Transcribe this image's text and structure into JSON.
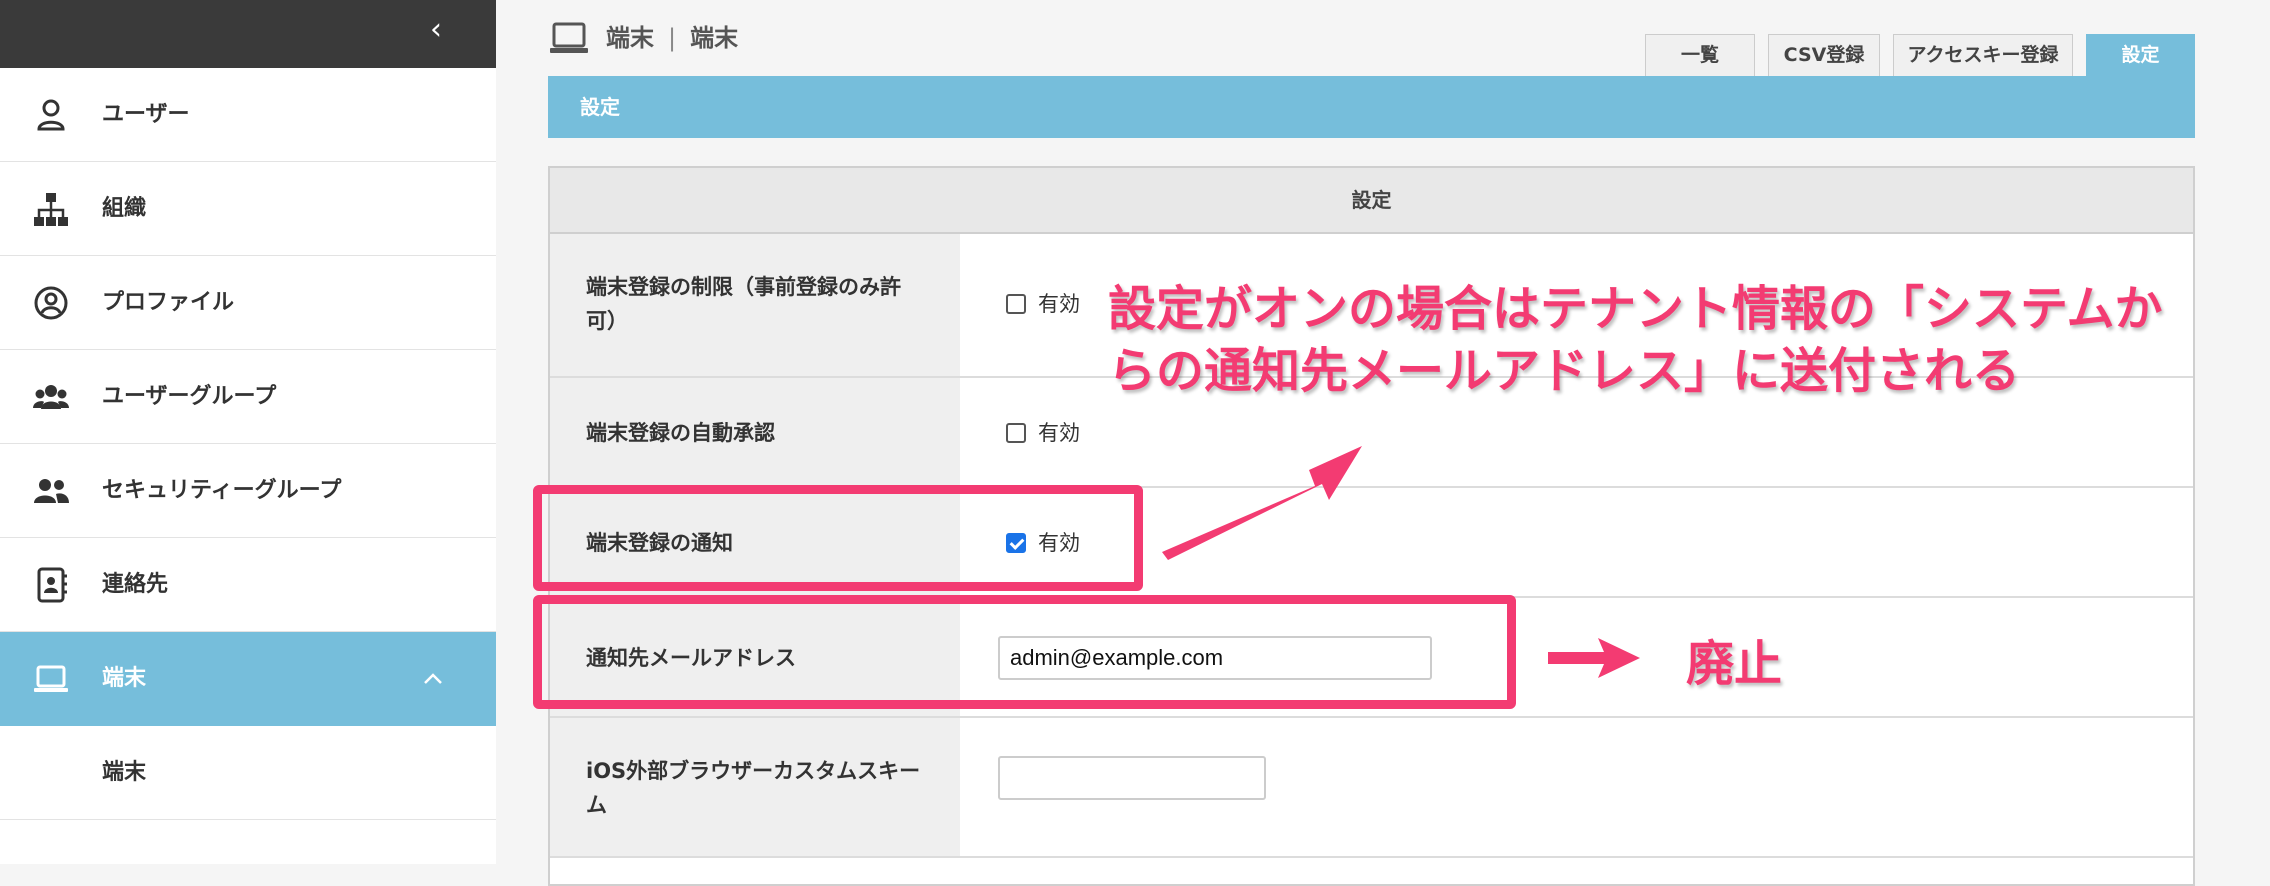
{
  "sidebar": {
    "items": [
      {
        "label": "ユーザー",
        "icon": "user-icon"
      },
      {
        "label": "組織",
        "icon": "org-chart-icon"
      },
      {
        "label": "プロファイル",
        "icon": "profile-circle-icon"
      },
      {
        "label": "ユーザーグループ",
        "icon": "users-group-icon"
      },
      {
        "label": "セキュリティーグループ",
        "icon": "security-group-icon"
      },
      {
        "label": "連絡先",
        "icon": "contact-book-icon"
      },
      {
        "label": "端末",
        "icon": "laptop-icon"
      }
    ],
    "sub_items": [
      {
        "label": "端末"
      }
    ],
    "collapse_icon": "chevron-left-icon"
  },
  "header": {
    "breadcrumb_1": "端末",
    "breadcrumb_sep": "|",
    "breadcrumb_2": "端末",
    "tabs": [
      {
        "label": "一覧"
      },
      {
        "label": "CSV登録"
      },
      {
        "label": "アクセスキー登録"
      },
      {
        "label": "設定"
      }
    ],
    "active_tab": "設定"
  },
  "panel": {
    "title": "設定",
    "table_header": "設定",
    "rows": [
      {
        "label": "端末登録の制限（事前登録のみ許可）",
        "checkbox_label": "有効",
        "checked": false
      },
      {
        "label": "端末登録の自動承認",
        "checkbox_label": "有効",
        "checked": false
      },
      {
        "label": "端末登録の通知",
        "checkbox_label": "有効",
        "checked": true
      },
      {
        "label": "通知先メールアドレス",
        "input_value": "admin@example.com"
      },
      {
        "label": "iOS外部ブラウザーカスタムスキーム",
        "input_value": ""
      }
    ]
  },
  "annotations": {
    "note_line1": "設定がオンの場合はテナント情報の「システムか",
    "note_line2": "らの通知先メールアドレス」に送付される",
    "deprecated": "廃止",
    "color": "#f33b72"
  },
  "colors": {
    "accent": "#76bedb",
    "sidebar_top": "#3a3a3a",
    "checkbox_checked": "#1a73e8"
  }
}
